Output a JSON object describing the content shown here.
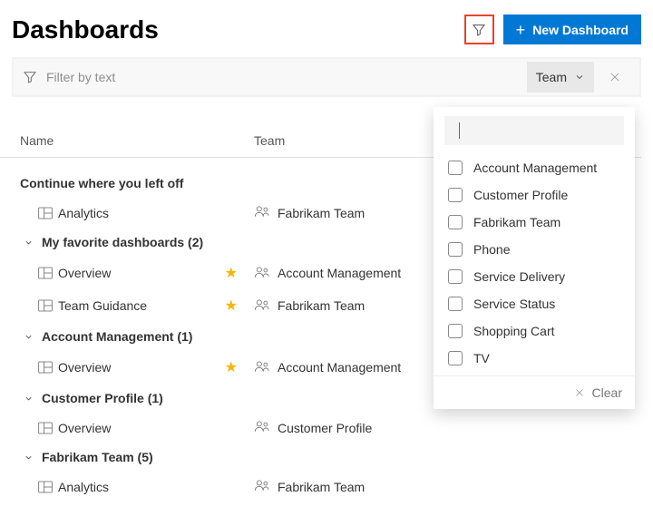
{
  "header": {
    "title": "Dashboards",
    "new_button": "New Dashboard"
  },
  "filter_bar": {
    "placeholder": "Filter by text",
    "team_dropdown": "Team"
  },
  "columns": {
    "name": "Name",
    "team": "Team"
  },
  "groups": [
    {
      "label": "Continue where you left off",
      "has_chevron": false,
      "rows": [
        {
          "name": "Analytics",
          "team": "Fabrikam Team",
          "fav": false
        }
      ]
    },
    {
      "label": "My favorite dashboards (2)",
      "has_chevron": true,
      "rows": [
        {
          "name": "Overview",
          "team": "Account Management",
          "fav": true
        },
        {
          "name": "Team Guidance",
          "team": "Fabrikam Team",
          "fav": true
        }
      ]
    },
    {
      "label": "Account Management (1)",
      "has_chevron": true,
      "rows": [
        {
          "name": "Overview",
          "team": "Account Management",
          "fav": true
        }
      ]
    },
    {
      "label": "Customer Profile (1)",
      "has_chevron": true,
      "rows": [
        {
          "name": "Overview",
          "team": "Customer Profile",
          "fav": false
        }
      ]
    },
    {
      "label": "Fabrikam Team (5)",
      "has_chevron": true,
      "rows": [
        {
          "name": "Analytics",
          "team": "Fabrikam Team",
          "fav": false
        }
      ]
    }
  ],
  "popup": {
    "options": [
      "Account Management",
      "Customer Profile",
      "Fabrikam Team",
      "Phone",
      "Service Delivery",
      "Service Status",
      "Shopping Cart",
      "TV"
    ],
    "clear": "Clear"
  }
}
